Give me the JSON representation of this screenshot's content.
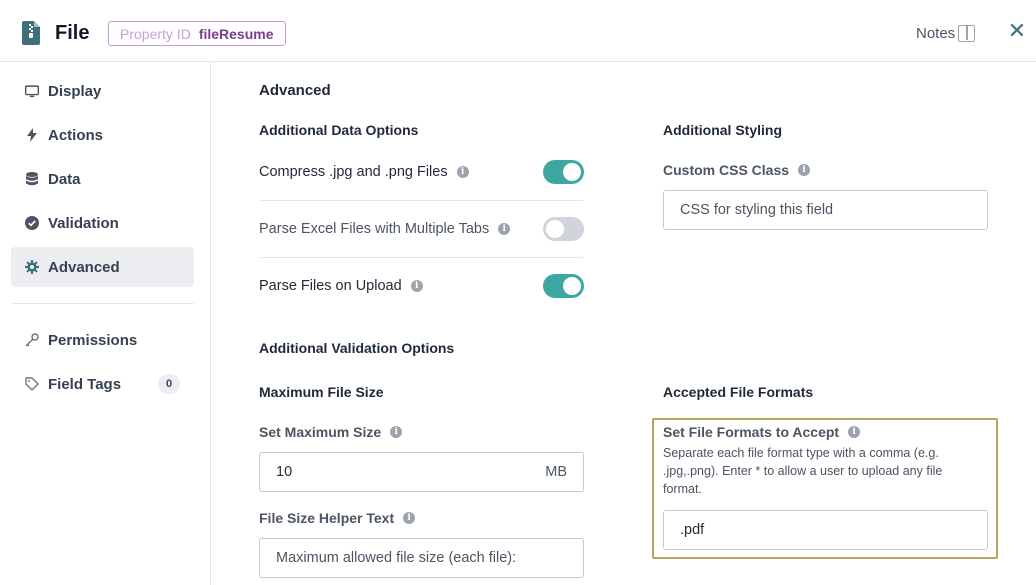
{
  "header": {
    "title": "File",
    "property_id_label": "Property ID",
    "property_id_value": "fileResume",
    "notes_label": "Notes",
    "close_icon": "close-icon"
  },
  "sidebar": {
    "items": [
      {
        "label": "Display",
        "icon": "monitor-icon"
      },
      {
        "label": "Actions",
        "icon": "lightning-icon"
      },
      {
        "label": "Data",
        "icon": "database-icon"
      },
      {
        "label": "Validation",
        "icon": "check-circle-icon"
      },
      {
        "label": "Advanced",
        "icon": "gear-icon",
        "active": true
      },
      {
        "label": "Permissions",
        "icon": "key-icon"
      },
      {
        "label": "Field Tags",
        "icon": "tag-icon",
        "count": "0"
      }
    ]
  },
  "main": {
    "section_title": "Advanced",
    "additional_data_options": {
      "title": "Additional Data Options",
      "options": [
        {
          "label": "Compress .jpg and .png Files",
          "enabled": true
        },
        {
          "label": "Parse Excel Files with Multiple Tabs",
          "enabled": false
        },
        {
          "label": "Parse Files on Upload",
          "enabled": true
        }
      ]
    },
    "additional_styling": {
      "title": "Additional Styling",
      "css_class_label": "Custom CSS Class",
      "css_class_placeholder": "CSS for styling this field"
    },
    "additional_validation_options": {
      "title": "Additional Validation Options",
      "max_file_size": {
        "title": "Maximum File Size",
        "set_label": "Set Maximum Size",
        "value": "10",
        "unit": "MB",
        "helper_label": "File Size Helper Text",
        "helper_placeholder": "Maximum allowed file size (each file):"
      },
      "accepted_formats": {
        "title": "Accepted File Formats",
        "set_label": "Set File Formats to Accept",
        "helper_text": "Separate each file format type with a comma (e.g. .jpg,.png). Enter * to allow a user to upload any file format.",
        "value": ".pdf"
      }
    }
  },
  "colors": {
    "accent_teal": "#3fa7a2",
    "badge_purple": "#7a3d8f",
    "highlight_border": "#b7a55a"
  }
}
